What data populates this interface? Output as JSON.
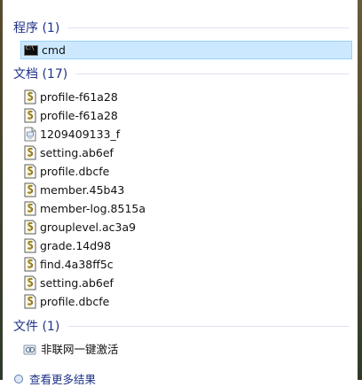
{
  "groups": {
    "programs": {
      "title": "程序 (1)",
      "items": [
        {
          "label": "cmd",
          "icon": "cmd-icon"
        }
      ]
    },
    "documents": {
      "title": "文档 (17)",
      "items": [
        {
          "label": "profile-f61a28",
          "icon": "script-file-icon"
        },
        {
          "label": "profile-f61a28",
          "icon": "script-file-icon"
        },
        {
          "label": "1209409133_f",
          "icon": "generic-file-icon"
        },
        {
          "label": "setting.ab6ef",
          "icon": "script-file-icon"
        },
        {
          "label": "profile.dbcfe",
          "icon": "script-file-icon"
        },
        {
          "label": "member.45b43",
          "icon": "script-file-icon"
        },
        {
          "label": "member-log.8515a",
          "icon": "script-file-icon"
        },
        {
          "label": "grouplevel.ac3a9",
          "icon": "script-file-icon"
        },
        {
          "label": "grade.14d98",
          "icon": "script-file-icon"
        },
        {
          "label": "find.4a38ff5c",
          "icon": "script-file-icon"
        },
        {
          "label": "setting.ab6ef",
          "icon": "script-file-icon"
        },
        {
          "label": "profile.dbcfe",
          "icon": "script-file-icon"
        }
      ]
    },
    "files": {
      "title": "文件 (1)",
      "items": [
        {
          "label": "非联网一键激活",
          "icon": "network-shortcut-icon"
        }
      ]
    }
  },
  "footer": {
    "more_results": "查看更多结果"
  },
  "colors": {
    "group_title": "#1e3287",
    "selected_bg": "#cce8ff",
    "selected_border": "#99d1ff"
  }
}
